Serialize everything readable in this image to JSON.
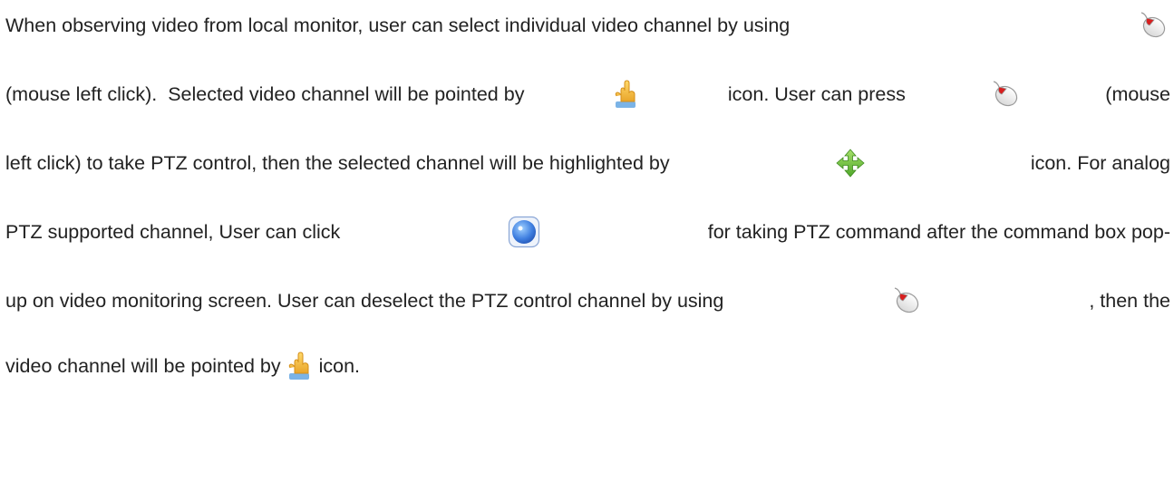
{
  "document": {
    "lines": [
      {
        "segments": [
          "When observing video from local monitor, user can select individual video channel by using"
        ],
        "trailing_icon": "mouse-left-click-icon"
      },
      {
        "segments": [
          "(mouse left click).  Selected video channel will be pointed by",
          "icon. User can press",
          "(mouse"
        ],
        "icons": [
          "pointing-hand-icon",
          "mouse-left-click-icon"
        ]
      },
      {
        "segments": [
          "left click) to take PTZ control, then the selected channel will be highlighted by",
          "icon. For analog"
        ],
        "icons": [
          "move-arrows-icon"
        ]
      },
      {
        "segments": [
          "PTZ supported channel, User can click",
          "for taking PTZ command after the command box pop-"
        ],
        "icons": [
          "ptz-command-icon"
        ]
      },
      {
        "segments": [
          "up on video monitoring screen. User can deselect the PTZ control channel by using",
          ", then the"
        ],
        "icons": [
          "mouse-left-click-icon"
        ]
      },
      {
        "segments": [
          "video channel will be pointed by",
          "icon."
        ],
        "icons": [
          "pointing-hand-icon"
        ]
      }
    ]
  },
  "icon_colors": {
    "mouse_body": "#f4f4f4",
    "mouse_outline": "#9a9a9a",
    "mouse_button": "#d81e1e",
    "hand_skin": "#f6c64a",
    "hand_shadow": "#d48f1a",
    "hand_cuff": "#7bb3e6",
    "move_arrows": "#7ccb3a",
    "ptz_blue": "#3f7fe0"
  }
}
